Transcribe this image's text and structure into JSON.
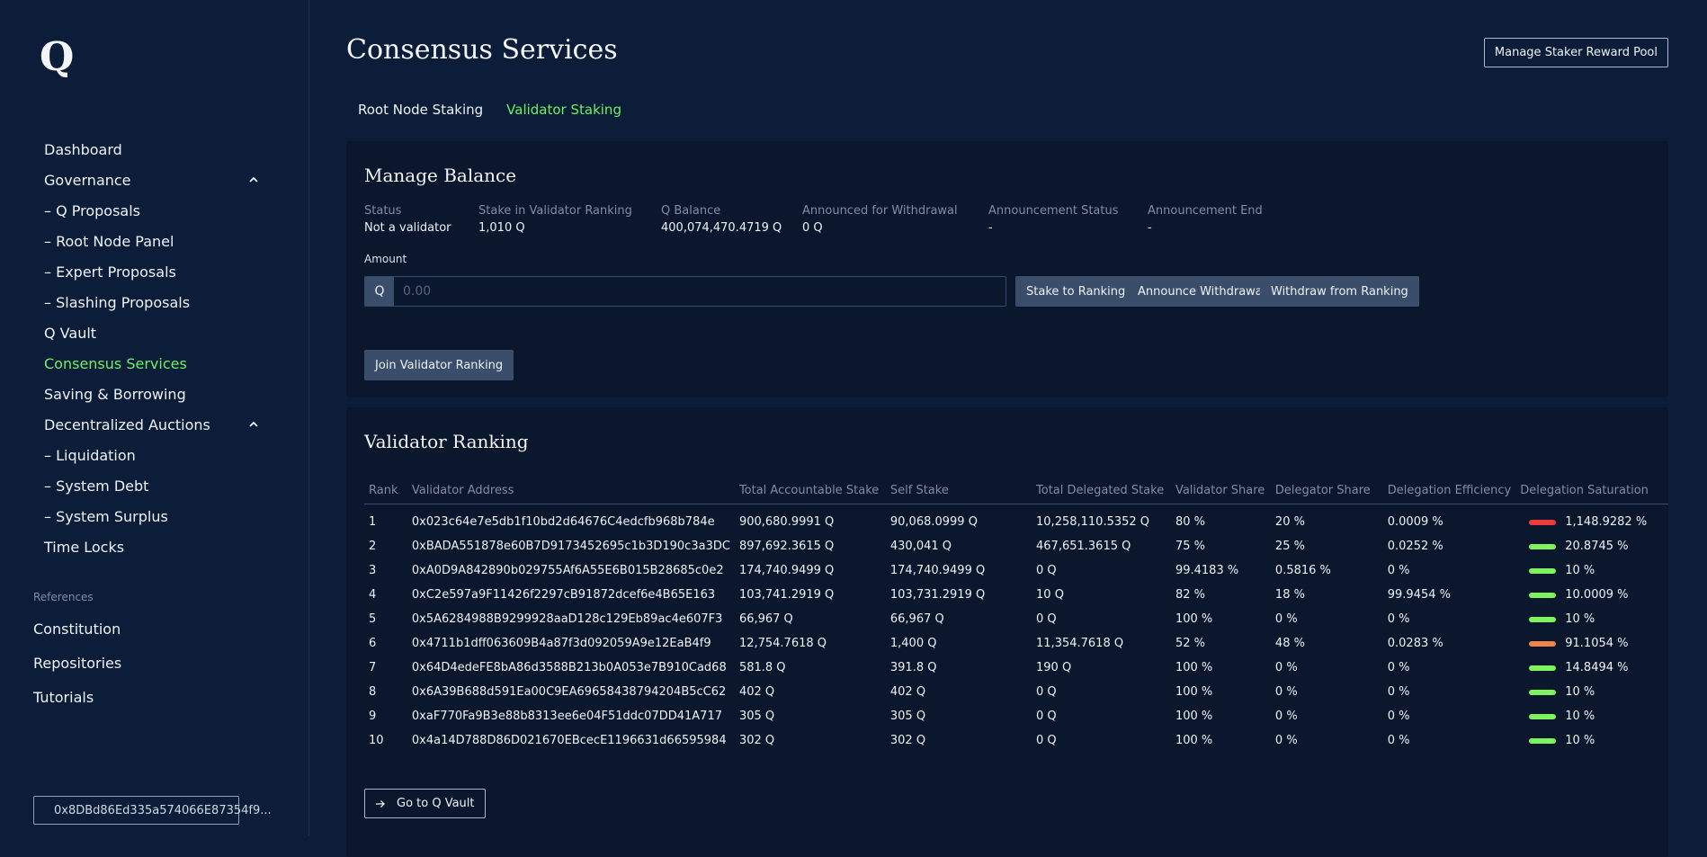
{
  "sidebar": {
    "logo": "Q",
    "nav": [
      {
        "label": "Dashboard"
      },
      {
        "label": "Governance",
        "expanded": true
      },
      {
        "label": "– Q Proposals"
      },
      {
        "label": "– Root Node Panel"
      },
      {
        "label": "– Expert Proposals"
      },
      {
        "label": "– Slashing Proposals"
      },
      {
        "label": "Q Vault"
      },
      {
        "label": "Consensus Services",
        "active": true
      },
      {
        "label": "Saving & Borrowing"
      },
      {
        "label": "Decentralized Auctions",
        "expanded": true
      },
      {
        "label": "– Liquidation"
      },
      {
        "label": "– System Debt"
      },
      {
        "label": "– System Surplus"
      },
      {
        "label": "Time Locks"
      }
    ],
    "references_label": "References",
    "references": [
      "Constitution",
      "Repositories",
      "Tutorials"
    ],
    "wallet_address": "0x8DBd86Ed335a574066E87354f9..."
  },
  "header": {
    "title": "Consensus Services",
    "reward_pool_button": "Manage Staker Reward Pool",
    "tabs": [
      {
        "label": "Root Node Staking"
      },
      {
        "label": "Validator Staking",
        "active": true
      }
    ]
  },
  "manage_balance": {
    "title": "Manage Balance",
    "stats": [
      {
        "label": "Status",
        "value": "Not a validator"
      },
      {
        "label": "Stake in Validator Ranking",
        "value": "1,010 Q"
      },
      {
        "label": "Q Balance",
        "value": "400,074,470.4719 Q"
      },
      {
        "label": "Announced for Withdrawal",
        "value": "0 Q"
      },
      {
        "label": "Announcement Status",
        "value": "-"
      },
      {
        "label": "Announcement End",
        "value": "-"
      }
    ],
    "amount_label": "Amount",
    "amount_prefix": "Q",
    "amount_placeholder": "0.00",
    "buttons": {
      "stake": "Stake to Ranking",
      "announce": "Announce Withdrawal",
      "withdraw": "Withdraw from Ranking",
      "join": "Join Validator Ranking"
    }
  },
  "validator_ranking": {
    "title": "Validator Ranking",
    "columns": [
      "Rank",
      "Validator Address",
      "Total Accountable Stake",
      "Self Stake",
      "Total Delegated Stake",
      "Validator Share",
      "Delegator Share",
      "Delegation Efficiency",
      "Delegation Saturation"
    ],
    "rows": [
      {
        "rank": "1",
        "address": "0x023c64e7e5db1f10bd2d64676C4edcfb968b784e",
        "total": "900,680.9991 Q",
        "self": "90,068.0999 Q",
        "delegated": "10,258,110.5352 Q",
        "vshare": "80 %",
        "dshare": "20 %",
        "eff": "0.0009 %",
        "sat": "1,148.9282 %",
        "sat_color": "#ef3b3b"
      },
      {
        "rank": "2",
        "address": "0xBADA551878e60B7D9173452695c1b3D190c3a3DC",
        "total": "897,692.3615 Q",
        "self": "430,041 Q",
        "delegated": "467,651.3615 Q",
        "vshare": "75 %",
        "dshare": "25 %",
        "eff": "0.0252 %",
        "sat": "20.8745 %",
        "sat_color": "#7ef25f"
      },
      {
        "rank": "3",
        "address": "0xA0D9A842890b029755Af6A55E6B015B28685c0e2",
        "total": "174,740.9499 Q",
        "self": "174,740.9499 Q",
        "delegated": "0 Q",
        "vshare": "99.4183 %",
        "dshare": "0.5816 %",
        "eff": "0 %",
        "sat": "10 %",
        "sat_color": "#7ef25f"
      },
      {
        "rank": "4",
        "address": "0xC2e597a9F11426f2297cB91872dcef6e4B65E163",
        "total": "103,741.2919 Q",
        "self": "103,731.2919 Q",
        "delegated": "10 Q",
        "vshare": "82 %",
        "dshare": "18 %",
        "eff": "99.9454 %",
        "sat": "10.0009 %",
        "sat_color": "#7ef25f"
      },
      {
        "rank": "5",
        "address": "0x5A6284988B9299928aaD128c129Eb89ac4e607F3",
        "total": "66,967 Q",
        "self": "66,967 Q",
        "delegated": "0 Q",
        "vshare": "100 %",
        "dshare": "0 %",
        "eff": "0 %",
        "sat": "10 %",
        "sat_color": "#7ef25f"
      },
      {
        "rank": "6",
        "address": "0x4711b1dff063609B4a87f3d092059A9e12EaB4f9",
        "total": "12,754.7618 Q",
        "self": "1,400 Q",
        "delegated": "11,354.7618 Q",
        "vshare": "52 %",
        "dshare": "48 %",
        "eff": "0.0283 %",
        "sat": "91.1054 %",
        "sat_color": "#f0824a"
      },
      {
        "rank": "7",
        "address": "0x64D4edeFE8bA86d3588B213b0A053e7B910Cad68",
        "total": "581.8 Q",
        "self": "391.8 Q",
        "delegated": "190 Q",
        "vshare": "100 %",
        "dshare": "0 %",
        "eff": "0 %",
        "sat": "14.8494 %",
        "sat_color": "#7ef25f"
      },
      {
        "rank": "8",
        "address": "0x6A39B688d591Ea00C9EA69658438794204B5cC62",
        "total": "402 Q",
        "self": "402 Q",
        "delegated": "0 Q",
        "vshare": "100 %",
        "dshare": "0 %",
        "eff": "0 %",
        "sat": "10 %",
        "sat_color": "#7ef25f"
      },
      {
        "rank": "9",
        "address": "0xaF770Fa9B3e88b8313ee6e04F51ddc07DD41A717",
        "total": "305 Q",
        "self": "305 Q",
        "delegated": "0 Q",
        "vshare": "100 %",
        "dshare": "0 %",
        "eff": "0 %",
        "sat": "10 %",
        "sat_color": "#7ef25f"
      },
      {
        "rank": "10",
        "address": "0x4a14D788D86D021670EBcecE1196631d66595984",
        "total": "302 Q",
        "self": "302 Q",
        "delegated": "0 Q",
        "vshare": "100 %",
        "dshare": "0 %",
        "eff": "0 %",
        "sat": "10 %",
        "sat_color": "#7ef25f"
      }
    ],
    "vault_button": "Go to Q Vault"
  },
  "colors": {
    "accent": "#6df062",
    "background": "#0b1d38",
    "card": "#0a172d",
    "button": "#3a4d6b"
  }
}
